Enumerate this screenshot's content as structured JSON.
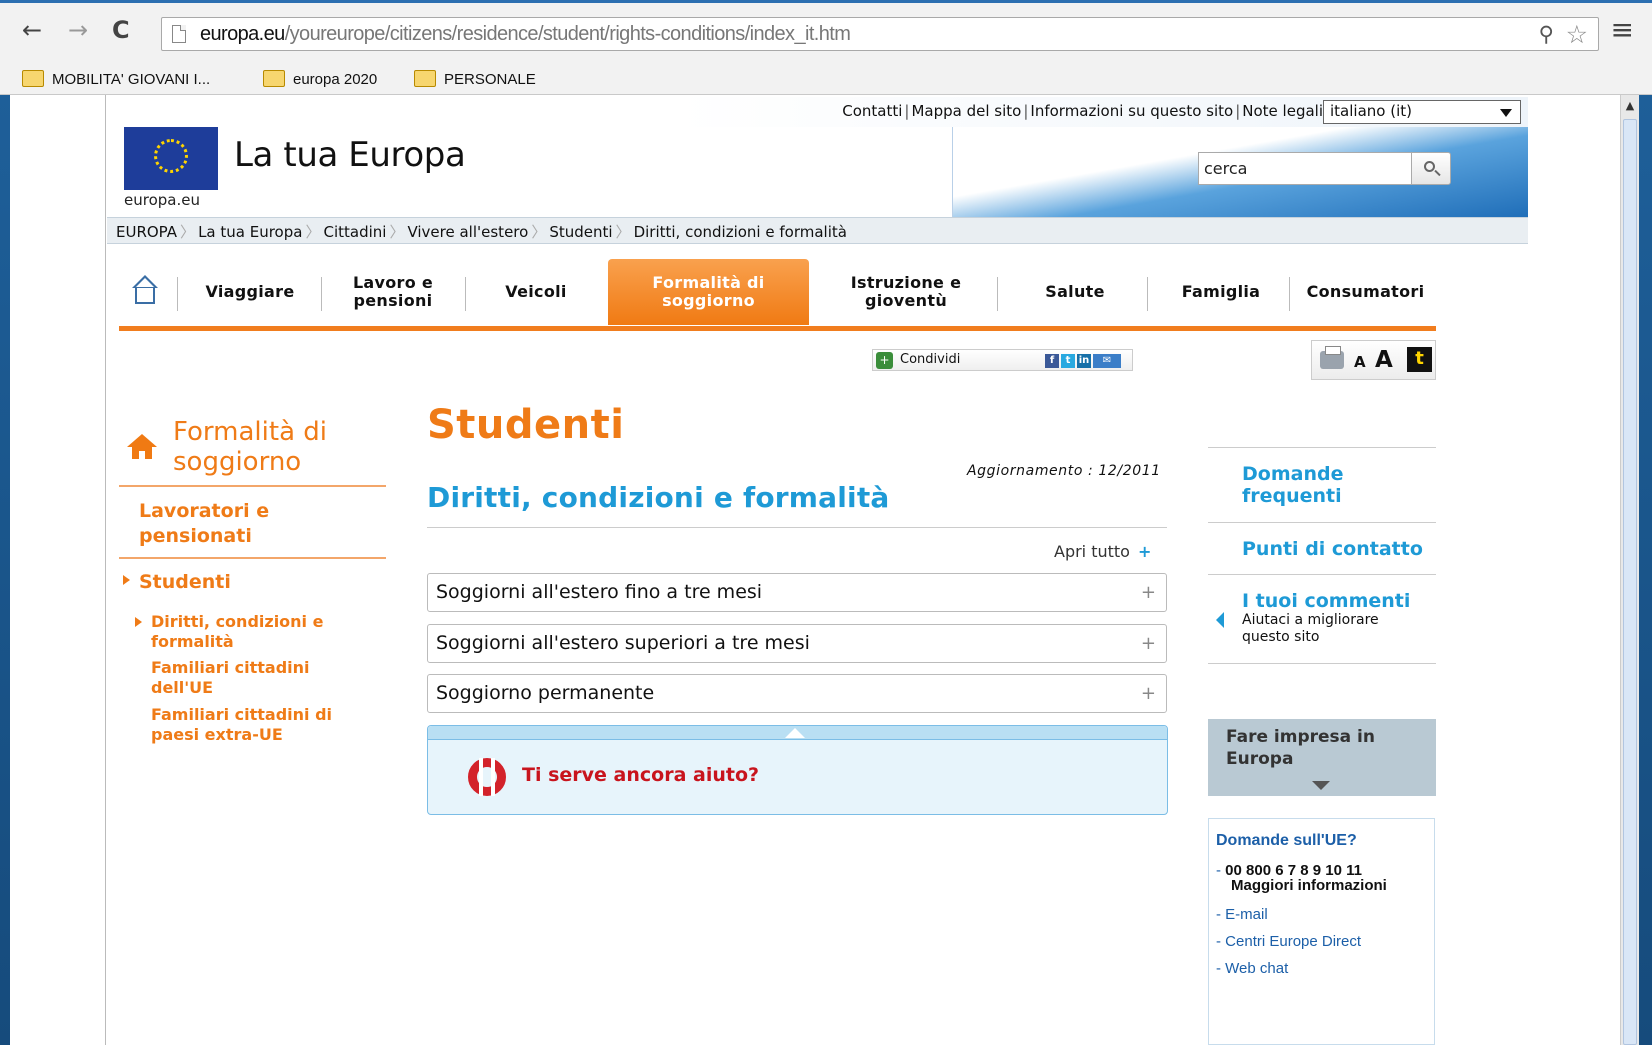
{
  "browser": {
    "url_domain": "europa.eu",
    "url_path": "/youreurope/citizens/residence/student/rights-conditions/index_it.htm",
    "bookmarks": [
      "MOBILITA' GIOVANI I...",
      "europa 2020",
      "PERSONALE"
    ]
  },
  "header": {
    "top_links": [
      "Contatti",
      "Mappa del sito",
      "Informazioni su questo sito",
      "Note legali"
    ],
    "language": "italiano (it)",
    "site_title": "La tua Europa",
    "site_sub": "europa.eu",
    "search_placeholder": "cerca"
  },
  "breadcrumb": [
    "EUROPA",
    "La tua Europa",
    "Cittadini",
    "Vivere all'estero",
    "Studenti",
    "Diritti, condizioni e formalità"
  ],
  "nav": {
    "items": [
      {
        "label": "Viaggiare"
      },
      {
        "label": "Lavoro e pensioni"
      },
      {
        "label": "Veicoli"
      },
      {
        "label": "Formalità di soggiorno"
      },
      {
        "label": "Istruzione e gioventù"
      },
      {
        "label": "Salute"
      },
      {
        "label": "Famiglia"
      },
      {
        "label": "Consumatori"
      }
    ],
    "active_index": 3
  },
  "share": {
    "label": "Condividi"
  },
  "tools": {
    "a_small": "A",
    "a_big": "A",
    "t": "t"
  },
  "sidebar": {
    "title": "Formalità di soggiorno",
    "links": [
      "Lavoratori e pensionati",
      "Studenti"
    ],
    "sub": [
      "Diritti, condizioni e formalità",
      "Familiari cittadini dell'UE",
      "Familiari cittadini di paesi extra-UE"
    ]
  },
  "main": {
    "title": "Studenti",
    "updated": "Aggiornamento : 12/2011",
    "subtitle": "Diritti, condizioni e formalità",
    "open_all": "Apri tutto",
    "accordions": [
      "Soggiorni all'estero fino a tre mesi",
      "Soggiorni all'estero superiori a tre mesi",
      "Soggiorno permanente"
    ],
    "help": "Ti serve ancora aiuto?"
  },
  "right": {
    "faq": "Domande frequenti",
    "contacts": "Punti di contatto",
    "comments": "I tuoi commenti",
    "comments_sub": "Aiutaci a migliorare questo sito",
    "business": "Fare impresa in Europa",
    "questions_title": "Domande sull'UE?",
    "phone": "00 800 6 7 8 9 10 11",
    "more": "Maggiori informazioni",
    "email": "E-mail",
    "centers": "Centri Europe Direct",
    "chat": "Web chat"
  },
  "colors": {
    "accent_orange": "#f07a13",
    "link_blue": "#1e9ad6",
    "help_red": "#c8141d"
  }
}
